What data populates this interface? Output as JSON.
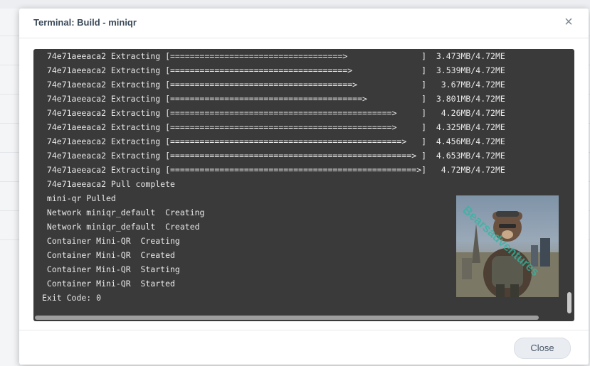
{
  "dialog": {
    "title": "Terminal: Build - miniqr",
    "close_icon": "close-icon",
    "close_button_label": "Close"
  },
  "terminal": {
    "lines": [
      " 74e71aeeaca2 Extracting [===================================>               ]  3.473MB/4.72ME",
      " 74e71aeeaca2 Extracting [====================================>              ]  3.539MB/4.72ME",
      " 74e71aeeaca2 Extracting [=====================================>             ]   3.67MB/4.72ME",
      " 74e71aeeaca2 Extracting [=======================================>           ]  3.801MB/4.72ME",
      " 74e71aeeaca2 Extracting [=============================================>     ]   4.26MB/4.72ME",
      " 74e71aeeaca2 Extracting [=============================================>     ]  4.325MB/4.72ME",
      " 74e71aeeaca2 Extracting [===============================================>   ]  4.456MB/4.72ME",
      " 74e71aeeaca2 Extracting [=================================================> ]  4.653MB/4.72ME",
      " 74e71aeeaca2 Extracting [==================================================>]   4.72MB/4.72ME",
      " 74e71aeeaca2 Pull complete",
      " mini-qr Pulled",
      " Network miniqr_default  Creating",
      " Network miniqr_default  Created",
      " Container Mini-QR  Creating",
      " Container Mini-QR  Created",
      " Container Mini-QR  Starting",
      " Container Mini-QR  Started",
      "Exit Code: 0"
    ],
    "watermark_text": "Bearsadventures"
  }
}
